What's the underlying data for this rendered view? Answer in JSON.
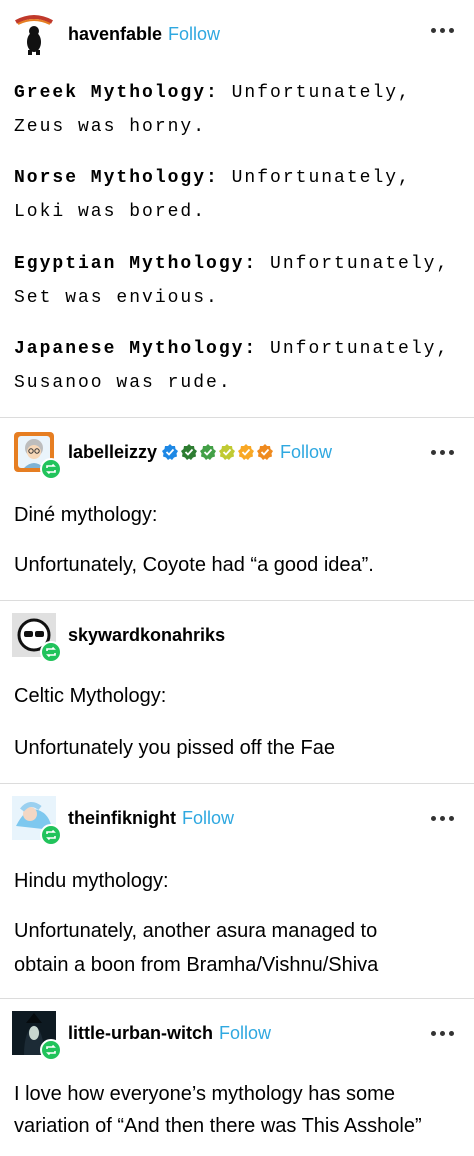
{
  "posts": [
    {
      "username": "havenfable",
      "follow": "Follow",
      "blocks": [
        {
          "heading": "Greek Mythology:",
          "rest": " Unfortunately,",
          "line2": "Zeus was horny."
        },
        {
          "heading": "Norse Mythology:",
          "rest": " Unfortunately,",
          "line2": "Loki was bored."
        },
        {
          "heading": "Egyptian Mythology:",
          "rest": " Unfortunately,",
          "line2": "Set was envious."
        },
        {
          "heading": "Japanese Mythology:",
          "rest": " Unfortunately,",
          "line2": "Susanoo was rude."
        }
      ]
    },
    {
      "username": "labelleizzy",
      "follow": "Follow",
      "badge_colors": [
        "#1e88e5",
        "#2e7d32",
        "#43a047",
        "#c0ca33",
        "#f9a825",
        "#ef8a1f"
      ],
      "p1": "Diné mythology:",
      "p2": "Unfortunately, Coyote had “a good idea”."
    },
    {
      "username": "skywardkonahriks",
      "p1": "Celtic Mythology:",
      "p2": "Unfortunately you pissed off the Fae"
    },
    {
      "username": "theinfiknight",
      "follow": "Follow",
      "p1": "Hindu mythology:",
      "p2a": "Unfortunately, another asura managed to",
      "p2b": "obtain a boon from Bramha/Vishnu/Shiva"
    },
    {
      "username": "little-urban-witch",
      "follow": "Follow",
      "p1a": "I love how everyone’s mythology has some",
      "p1b": "variation of “And then there was This Asshole”"
    }
  ],
  "colors": {
    "follow": "#2fa8e0",
    "reblog_badge": "#21c35b"
  }
}
